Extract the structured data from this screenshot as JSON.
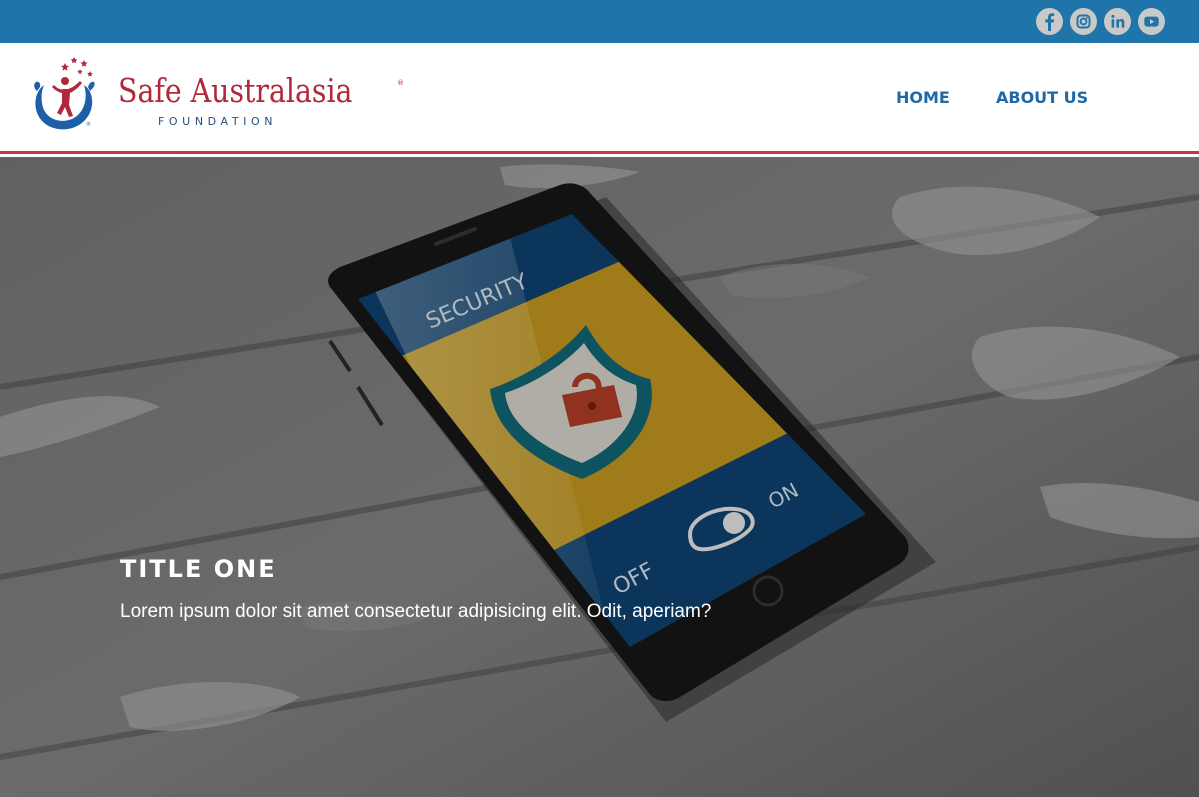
{
  "topbar": {
    "background": "#1f74aa",
    "social": [
      {
        "name": "facebook-icon"
      },
      {
        "name": "instagram-icon"
      },
      {
        "name": "linkedin-icon"
      },
      {
        "name": "youtube-icon"
      }
    ]
  },
  "header": {
    "logo": {
      "name": "Safe Australasia",
      "registered": "®",
      "subtitle": "FOUNDATION"
    },
    "nav": {
      "home": "HOME",
      "about": "ABOUT US"
    },
    "accent_color": "#c8364a",
    "nav_color": "#1f6aa6"
  },
  "hero": {
    "title": "TITLE ONE",
    "text": "Lorem ipsum dolor sit amet consectetur adipisicing elit. Odit, aperiam?",
    "phone_screen": {
      "heading": "SECURITY",
      "toggle_off": "OFF",
      "toggle_on": "ON"
    }
  }
}
